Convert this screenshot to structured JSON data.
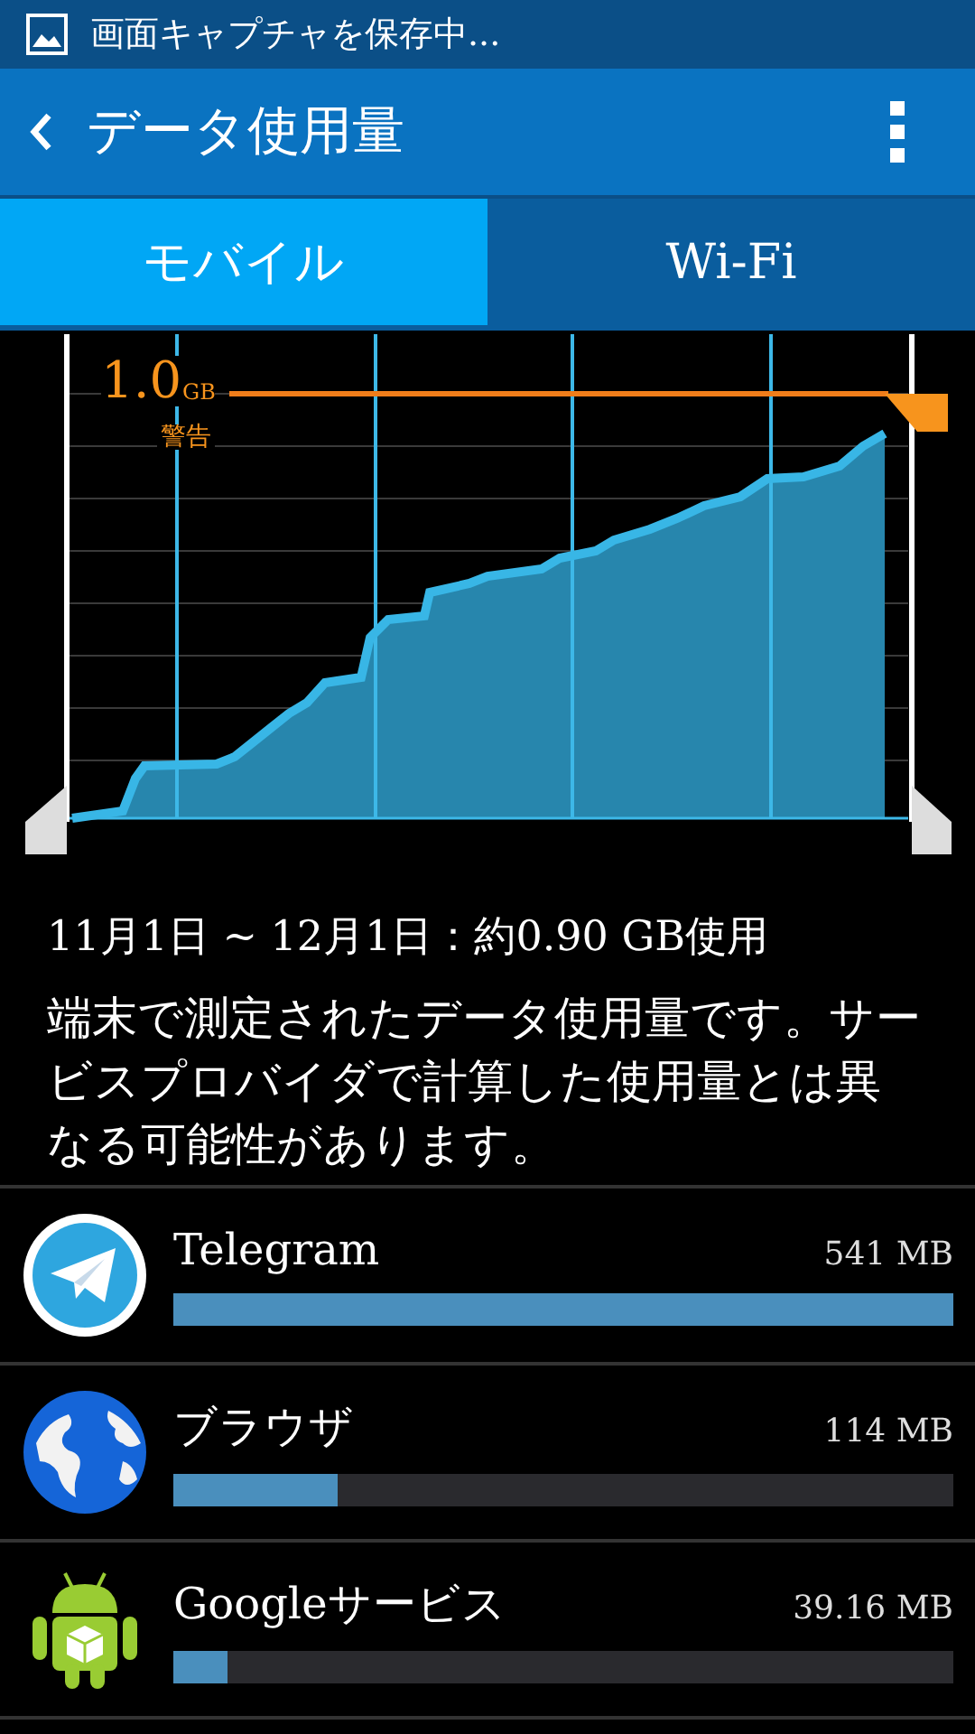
{
  "status_bar": {
    "notification": "画面キャプチャを保存中..."
  },
  "app_bar": {
    "title": "データ使用量"
  },
  "tabs": [
    {
      "label": "モバイル",
      "selected": true
    },
    {
      "label": "Wi-Fi",
      "selected": false
    }
  ],
  "chart": {
    "warning_value": "1.0",
    "warning_unit": "GB",
    "warning_label": "警告"
  },
  "summary": "11月1日 ~ 12月1日：約0.90 GB使用",
  "note": "端末で測定されたデータ使用量です。サービスプロバイダで計算した使用量とは異なる可能性があります。",
  "apps": [
    {
      "name": "Telegram",
      "usage": "541 MB",
      "level": 1.0,
      "kind": "telegram"
    },
    {
      "name": "ブラウザ",
      "usage": "114 MB",
      "level": 0.21,
      "kind": "browser"
    },
    {
      "name": "Googleサービス",
      "usage": "39.16 MB",
      "level": 0.07,
      "kind": "android"
    }
  ]
}
